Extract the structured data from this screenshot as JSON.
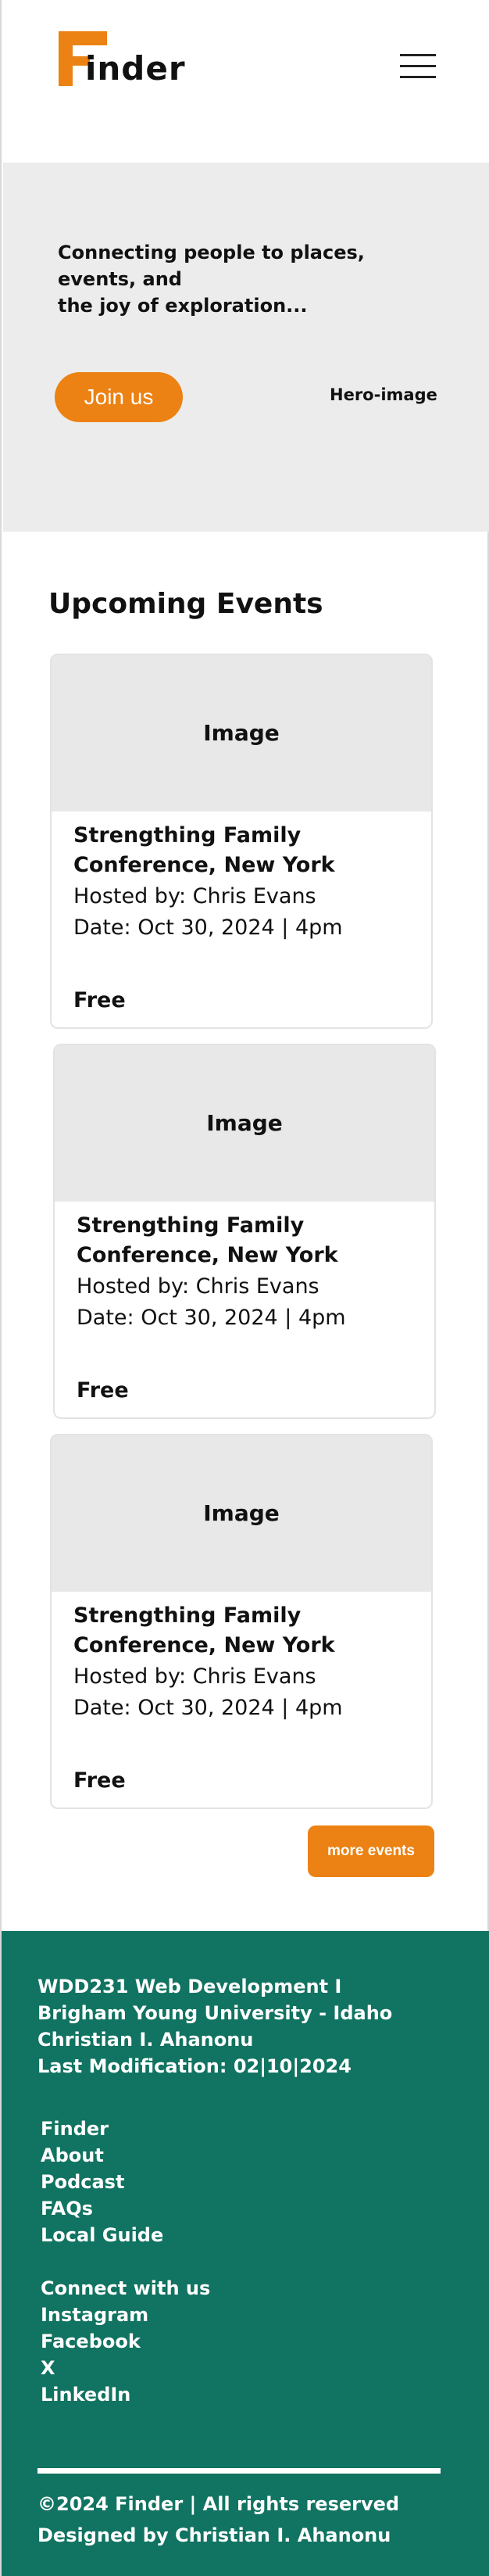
{
  "header": {
    "logo_text": "inder",
    "logo_alt": "Finder",
    "menu_icon": "hamburger-menu-icon"
  },
  "hero": {
    "tagline_line1": "Connecting people to places,",
    "tagline_line2": "events, and",
    "tagline_line3": "the joy of exploration...",
    "join_label": "Join us",
    "image_placeholder": "Hero-image"
  },
  "events": {
    "title": "Upcoming Events",
    "cards": [
      {
        "image_placeholder": "Image",
        "title": "Strengthing Family Conference, New York",
        "host": "Hosted by: Chris Evans",
        "date": "Date: Oct 30, 2024 | 4pm",
        "price": "Free"
      },
      {
        "image_placeholder": "Image",
        "title": "Strengthing Family Conference, New York",
        "host": "Hosted by: Chris Evans",
        "date": "Date: Oct 30, 2024 | 4pm",
        "price": "Free"
      },
      {
        "image_placeholder": "Image",
        "title": "Strengthing Family Conference, New York",
        "host": "Hosted by: Chris Evans",
        "date": "Date: Oct 30, 2024 | 4pm",
        "price": "Free"
      }
    ],
    "more_label": "more events"
  },
  "footer": {
    "info": [
      "WDD231 Web Development I",
      "Brigham Young University - Idaho",
      "Christian I. Ahanonu",
      "Last Modification: 02|10|2024"
    ],
    "links": [
      "Finder",
      "About",
      "Podcast",
      "FAQs",
      "Local Guide"
    ],
    "social_heading": "Connect with us",
    "social": [
      "Instagram",
      "Facebook",
      "X",
      "LinkedIn"
    ],
    "copyright": "©2024 Finder | All rights reserved",
    "designer": "Designed by Christian I. Ahanonu"
  },
  "colors": {
    "accent": "#ec8213",
    "footer_bg": "#117361",
    "hero_bg": "#ececec",
    "placeholder_bg": "#e8e8e8"
  }
}
